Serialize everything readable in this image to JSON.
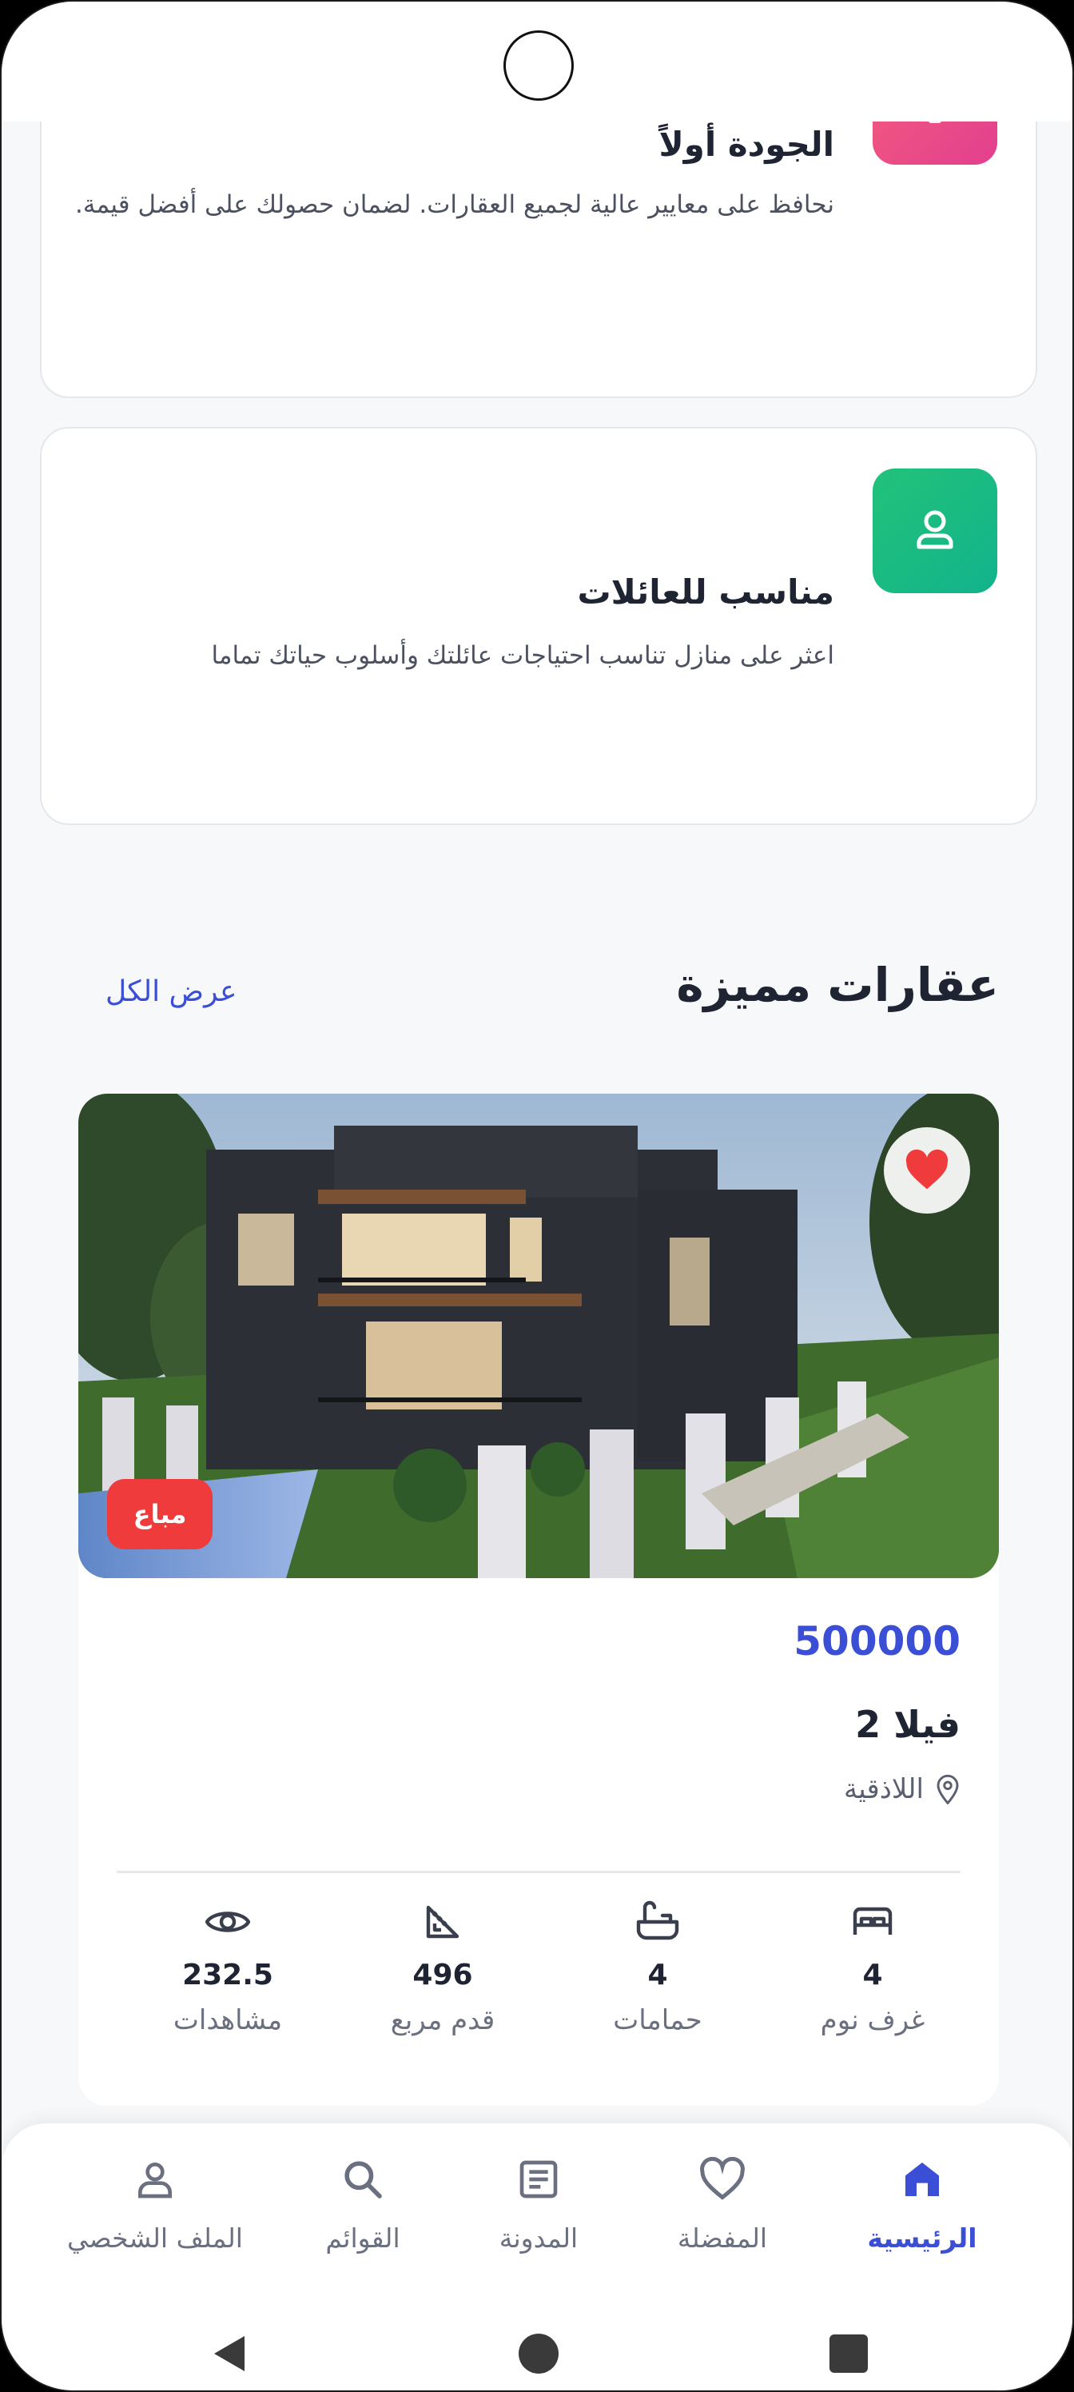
{
  "features": [
    {
      "title": "الجودة أولاً",
      "description": "نحافظ على معايير عالية لجميع العقارات. لضمان حصولك على أفضل قيمة.",
      "icon": "quality-icon",
      "color_from": "#f25a7e",
      "color_to": "#e23f8f"
    },
    {
      "title": "مناسب للعائلات",
      "description": "اعثر على منازل تناسب احتياجات عائلتك وأسلوب حياتك تماما",
      "icon": "user-icon",
      "color_from": "#22c27a",
      "color_to": "#12b38c"
    }
  ],
  "featured": {
    "title": "عقارات مميزة",
    "view_all": "عرض الكل"
  },
  "property": {
    "badge": "مباع",
    "price": "500000",
    "name": "فيلا 2",
    "location": "اللاذقية",
    "favorited": true,
    "stats": [
      {
        "icon": "bed-icon",
        "value": "4",
        "label": "غرف نوم"
      },
      {
        "icon": "bathtub-icon",
        "value": "4",
        "label": "حمامات"
      },
      {
        "icon": "area-ruler-icon",
        "value": "496",
        "label": "قدم مربع"
      },
      {
        "icon": "eye-icon",
        "value": "232.5",
        "label": "مشاهدات"
      }
    ]
  },
  "bottom_nav": [
    {
      "icon": "home-icon",
      "label": "الرئيسية",
      "active": true
    },
    {
      "icon": "heart-icon",
      "label": "المفضلة",
      "active": false
    },
    {
      "icon": "blog-icon",
      "label": "المدونة",
      "active": false
    },
    {
      "icon": "search-icon",
      "label": "القوائم",
      "active": false
    },
    {
      "icon": "profile-icon",
      "label": "الملف الشخصي",
      "active": false
    }
  ],
  "colors": {
    "accent": "#3b4fd6",
    "sold": "#ef3b3b",
    "favorite": "#ef3b3b"
  }
}
